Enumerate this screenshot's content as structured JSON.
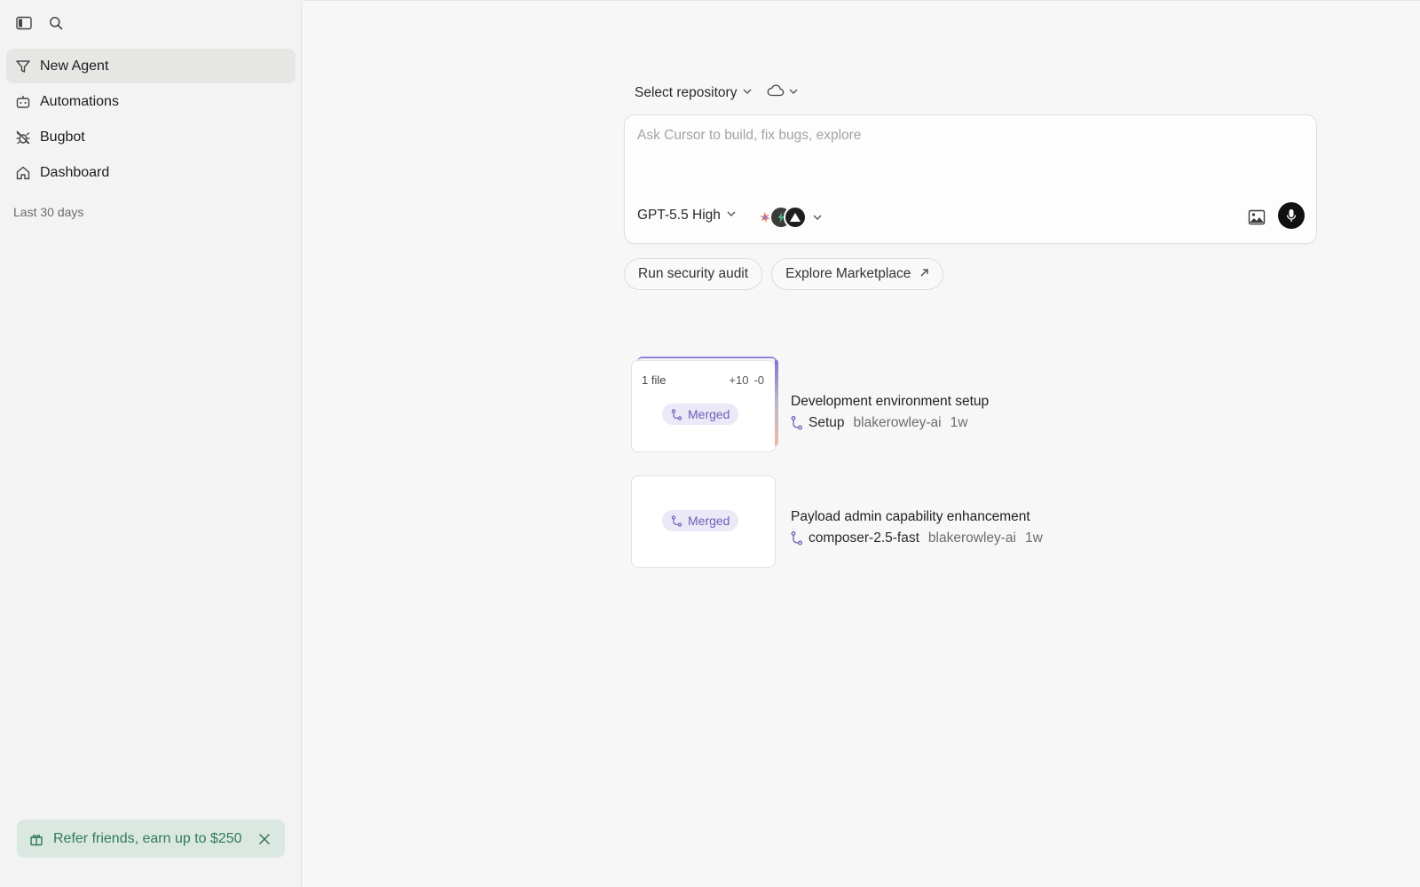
{
  "sidebar": {
    "items": [
      {
        "label": "New Agent",
        "icon": "funnel-icon",
        "active": true
      },
      {
        "label": "Automations",
        "icon": "robot-icon"
      },
      {
        "label": "Bugbot",
        "icon": "bug-icon"
      },
      {
        "label": "Dashboard",
        "icon": "home-icon"
      }
    ],
    "section_label": "Last 30 days",
    "referral": {
      "text": "Refer friends, earn up to $250",
      "color": "#2f7a5b"
    }
  },
  "composer": {
    "repo_label": "Select repository",
    "placeholder": "Ask Cursor to build, fix bugs, explore",
    "model_label": "GPT-5.5 High"
  },
  "chips": [
    {
      "label": "Run security audit"
    },
    {
      "label": "Explore Marketplace"
    }
  ],
  "tasks": [
    {
      "files": "1 file",
      "additions": "+10",
      "deletions": "-0",
      "status": "Merged",
      "title": "Development environment setup",
      "branch": "Setup",
      "owner": "blakerowley-ai",
      "age": "1w"
    },
    {
      "status": "Merged",
      "title": "Payload admin capability enhancement",
      "branch": "composer-2.5-fast",
      "owner": "blakerowley-ai",
      "age": "1w"
    }
  ],
  "colors": {
    "accent": "#6a62b8",
    "badge_bg": "#ebe9f7",
    "referral_bg": "#dbe8e2"
  }
}
